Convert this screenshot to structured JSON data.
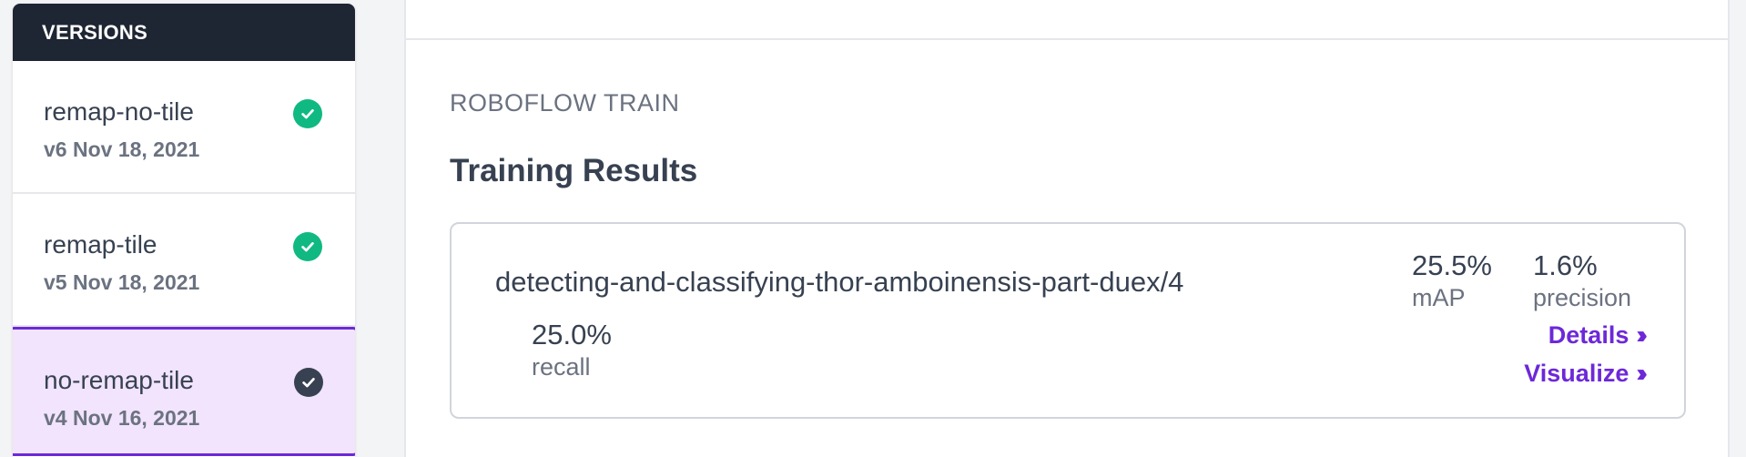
{
  "sidebar": {
    "header": "VERSIONS",
    "versions": [
      {
        "name": "remap-no-tile",
        "meta": "v6 Nov 18, 2021",
        "status_color": "#10b981"
      },
      {
        "name": "remap-tile",
        "meta": "v5 Nov 18, 2021",
        "status_color": "#10b981"
      },
      {
        "name": "no-remap-tile",
        "meta": "v4 Nov 16, 2021",
        "status_color": "#374151"
      }
    ],
    "selected_index": 2
  },
  "main": {
    "section_label": "ROBOFLOW TRAIN",
    "section_title": "Training Results",
    "result": {
      "model_name": "detecting-and-classifying-thor-amboinensis-part-duex/4",
      "map_value": "25.5%",
      "map_label": "mAP",
      "precision_value": "1.6%",
      "precision_label": "precision",
      "recall_value": "25.0%",
      "recall_label": "recall",
      "details_label": "Details",
      "visualize_label": "Visualize"
    }
  },
  "colors": {
    "accent": "#6d28d9",
    "selected_bg": "#f1e4fc",
    "header_bg": "#1e2533",
    "success": "#10b981"
  }
}
